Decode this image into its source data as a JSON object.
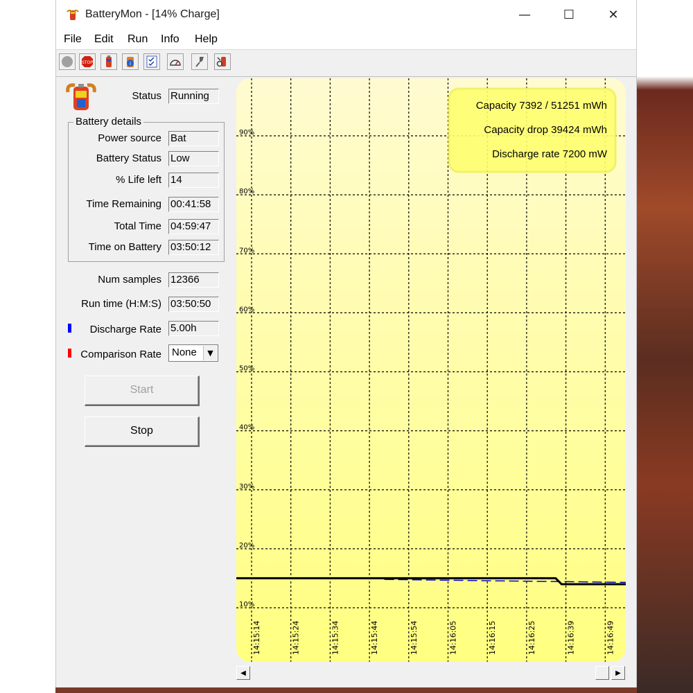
{
  "window": {
    "title": "BatteryMon - [14% Charge]",
    "minimize_glyph": "—",
    "maximize_glyph": "☐",
    "close_glyph": "✕"
  },
  "menu": [
    "File",
    "Edit",
    "Run",
    "Info",
    "Help"
  ],
  "toolbar_icons": [
    "record-icon",
    "stop-icon",
    "battery-icon",
    "battery-info-icon",
    "checklist-icon",
    "gauge-icon",
    "pin-icon",
    "battery-settings-icon"
  ],
  "status": {
    "label": "Status",
    "value": "Running"
  },
  "battery_details": {
    "title": "Battery details",
    "rows": [
      {
        "label": "Power source",
        "value": "Bat"
      },
      {
        "label": "Battery Status",
        "value": "Low"
      },
      {
        "label": "% Life left",
        "value": "14"
      },
      {
        "label": "Time Remaining",
        "value": "00:41:58"
      },
      {
        "label": "Total Time",
        "value": "04:59:47"
      },
      {
        "label": "Time on Battery",
        "value": "03:50:12"
      }
    ]
  },
  "stats": {
    "num_samples": {
      "label": "Num samples",
      "value": "12366"
    },
    "run_time": {
      "label": "Run time (H:M:S)",
      "value": "03:50:50"
    },
    "discharge_rate": {
      "label": "Discharge Rate",
      "value": "5.00h",
      "color": "#0000ff"
    },
    "comparison_rate": {
      "label": "Comparison Rate",
      "value": "None",
      "color": "#ff0000"
    }
  },
  "buttons": {
    "start": "Start",
    "stop": "Stop"
  },
  "colors": {
    "chart_bg_top": "#fffbd0",
    "chart_bg_bottom": "#ffff80",
    "info_box": "#ffff70",
    "charge_line": "#000000",
    "discharge_line": "#0000c0"
  },
  "chart_data": {
    "type": "line",
    "ylim": [
      10,
      100
    ],
    "y_ticks": [
      "10%",
      "20%",
      "30%",
      "40%",
      "50%",
      "60%",
      "70%",
      "80%",
      "90%"
    ],
    "y_tick_values": [
      10,
      20,
      30,
      40,
      50,
      60,
      70,
      80,
      90
    ],
    "x_ticks": [
      "14:15:14",
      "14:15:24",
      "14:15:34",
      "14:15:44",
      "14:15:54",
      "14:16:05",
      "14:16:15",
      "14:16:25",
      "14:16:39",
      "14:16:49"
    ],
    "series": [
      {
        "x": [
          0,
          0.82,
          0.835,
          1.0
        ],
        "y": [
          15.0,
          15.0,
          14.0,
          14.0
        ]
      },
      {
        "x": [
          0.38,
          1.0
        ],
        "y": [
          14.8,
          14.3
        ]
      }
    ],
    "annotations": [
      "Capacity 7392 / 51251 mWh",
      "Capacity drop 39424 mWh",
      "Discharge rate 7200 mW"
    ]
  }
}
